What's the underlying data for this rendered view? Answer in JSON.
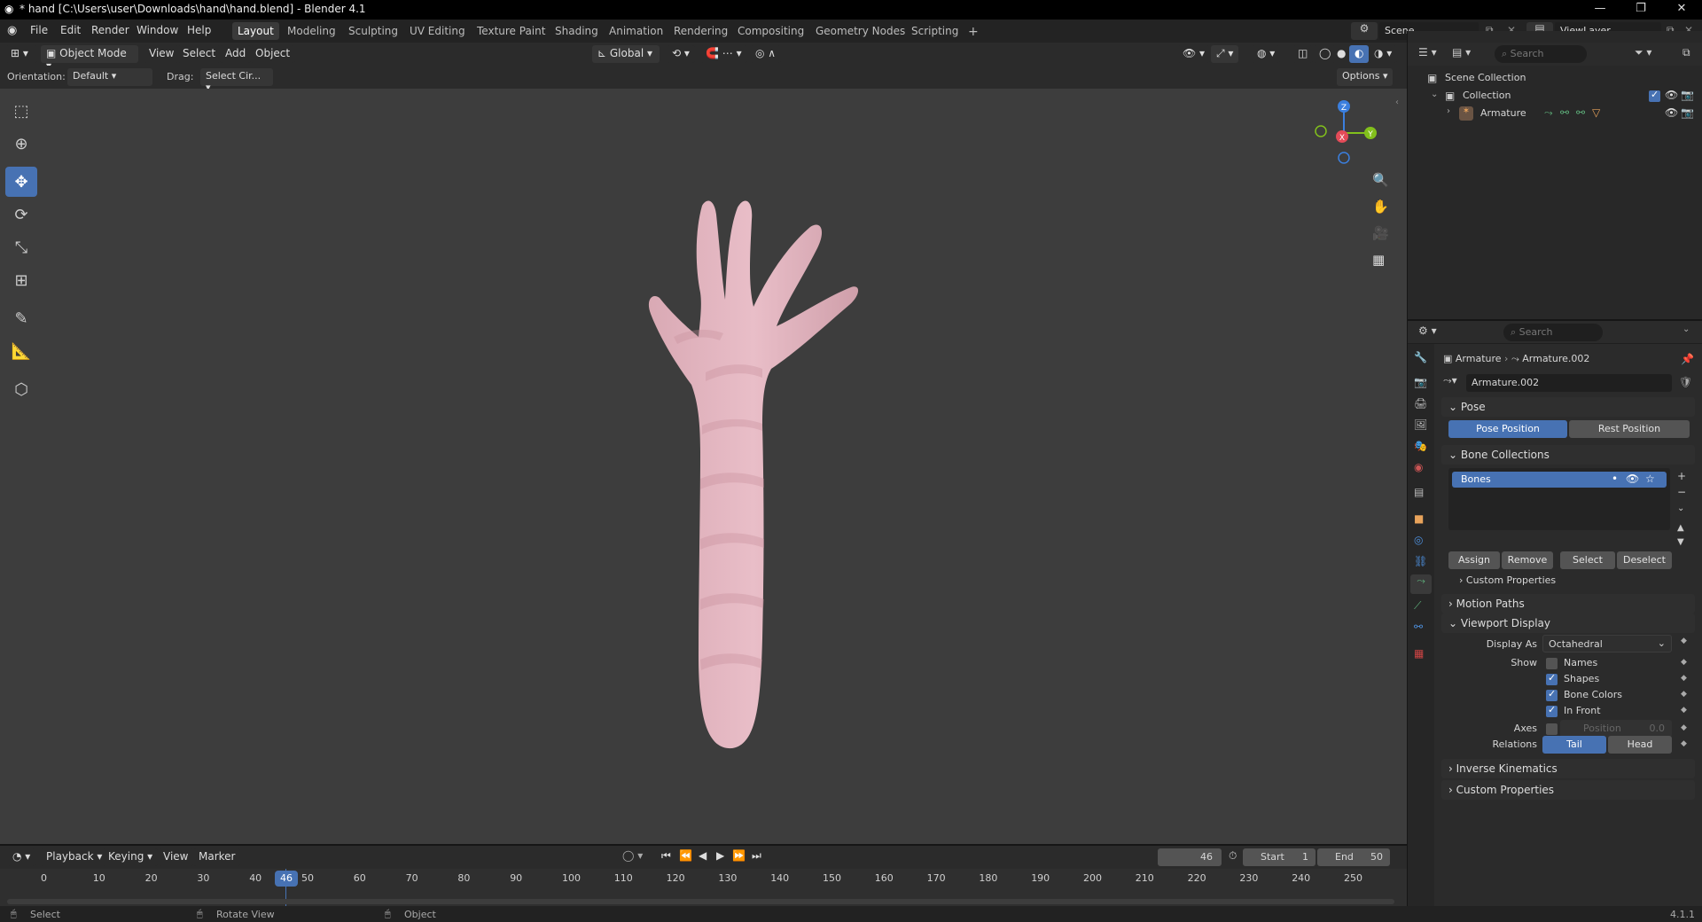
{
  "window": {
    "title": "* hand [C:\\Users\\user\\Downloads\\hand\\hand.blend] - Blender 4.1"
  },
  "menu": [
    "File",
    "Edit",
    "Render",
    "Window",
    "Help"
  ],
  "workspaces": [
    "Layout",
    "Modeling",
    "Sculpting",
    "UV Editing",
    "Texture Paint",
    "Shading",
    "Animation",
    "Rendering",
    "Compositing",
    "Geometry Nodes",
    "Scripting"
  ],
  "scene": {
    "name": "Scene",
    "view_layer": "ViewLayer"
  },
  "viewport_header": {
    "mode": "Object Mode",
    "menus": [
      "View",
      "Select",
      "Add",
      "Object"
    ],
    "transform": "Global",
    "options": "Options"
  },
  "tool_settings": {
    "orientation_label": "Orientation:",
    "orientation_value": "Default",
    "drag_label": "Drag:",
    "drag_value": "Select Cir..."
  },
  "gizmo": {
    "z": "Z",
    "x": "X",
    "y": "Y"
  },
  "outliner": {
    "search_placeholder": "Search",
    "scene_collection": "Scene Collection",
    "collection": "Collection",
    "armature": "Armature"
  },
  "properties": {
    "search_placeholder": "Search",
    "breadcrumb": [
      "Armature",
      "Armature.002"
    ],
    "datablock_name": "Armature.002",
    "pose": {
      "title": "Pose",
      "pose_position": "Pose Position",
      "rest_position": "Rest Position"
    },
    "bone_collections": {
      "title": "Bone Collections",
      "items": [
        "Bones"
      ],
      "buttons": [
        "Assign",
        "Remove",
        "Select",
        "Deselect"
      ],
      "custom_properties": "Custom Properties"
    },
    "motion_paths": "Motion Paths",
    "viewport_display": {
      "title": "Viewport Display",
      "display_as_label": "Display As",
      "display_as_value": "Octahedral",
      "show_label": "Show",
      "show_options": [
        {
          "label": "Names",
          "checked": false
        },
        {
          "label": "Shapes",
          "checked": true
        },
        {
          "label": "Bone Colors",
          "checked": true
        },
        {
          "label": "In Front",
          "checked": true
        }
      ],
      "axes_label": "Axes",
      "axes_position_label": "Position",
      "axes_position_value": "0.0",
      "relations_label": "Relations",
      "relations_tail": "Tail",
      "relations_head": "Head"
    },
    "inverse_kinematics": "Inverse Kinematics",
    "custom_properties": "Custom Properties"
  },
  "timeline": {
    "menus": [
      "Playback",
      "Keying",
      "View",
      "Marker"
    ],
    "current_frame": "46",
    "start_label": "Start",
    "start_value": "1",
    "end_label": "End",
    "end_value": "50",
    "ticks": [
      "0",
      "10",
      "20",
      "30",
      "40",
      "50",
      "60",
      "70",
      "80",
      "90",
      "100",
      "110",
      "120",
      "130",
      "140",
      "150",
      "160",
      "170",
      "180",
      "190",
      "200",
      "210",
      "220",
      "230",
      "240",
      "250"
    ]
  },
  "statusbar": {
    "select": "Select",
    "rotate": "Rotate View",
    "object": "Object",
    "version": "4.1.1"
  },
  "colors": {
    "accent": "#4772b3",
    "mesh": "#e7b9c3",
    "viewport_bg": "#3d3d3d"
  }
}
